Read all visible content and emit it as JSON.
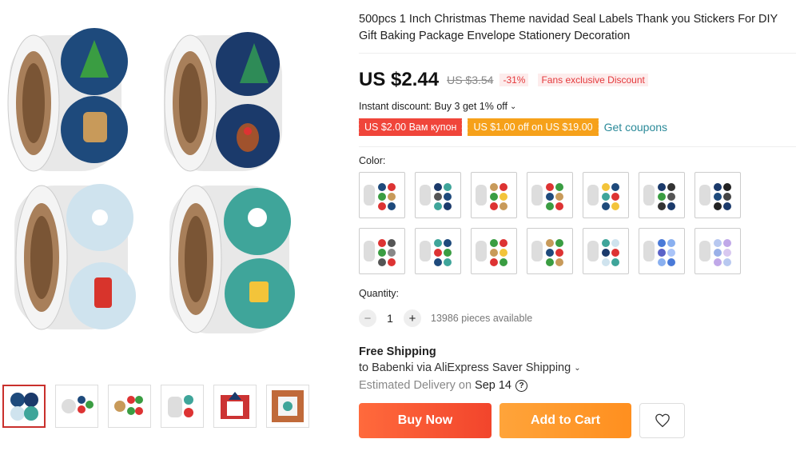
{
  "product": {
    "title": "500pcs 1 Inch Christmas Theme navidad Seal Labels Thank you Stickers For DIY Gift Baking Package Envelope Stationery Decoration"
  },
  "price": {
    "current": "US $2.44",
    "original": "US $3.54",
    "discount_pct": "-31%",
    "badge": "Fans exclusive Discount"
  },
  "promotions": {
    "instant_discount": "Instant discount: Buy 3 get 1% off",
    "coupon_1": "US $2.00 Вам купон",
    "coupon_2": "US $1.00 off on US $19.00",
    "get_coupons": "Get coupons"
  },
  "color": {
    "label": "Color:",
    "count": 14
  },
  "quantity": {
    "label": "Quantity:",
    "minus": "−",
    "value": "1",
    "plus": "+",
    "available": "13986 pieces available"
  },
  "shipping": {
    "title": "Free Shipping",
    "to": "to Babenki via AliExpress Saver Shipping",
    "estimated_label": "Estimated Delivery on",
    "estimated_date": "Sep 14",
    "help": "?"
  },
  "actions": {
    "buy_now": "Buy Now",
    "add_to_cart": "Add to Cart"
  },
  "icons": {
    "wishlist": "heart-icon",
    "dropdown": "chevron-down-icon"
  },
  "colors": {
    "accent_red": "#f0453a",
    "accent_orange": "#f6a11a",
    "link": "#2b8a99"
  }
}
